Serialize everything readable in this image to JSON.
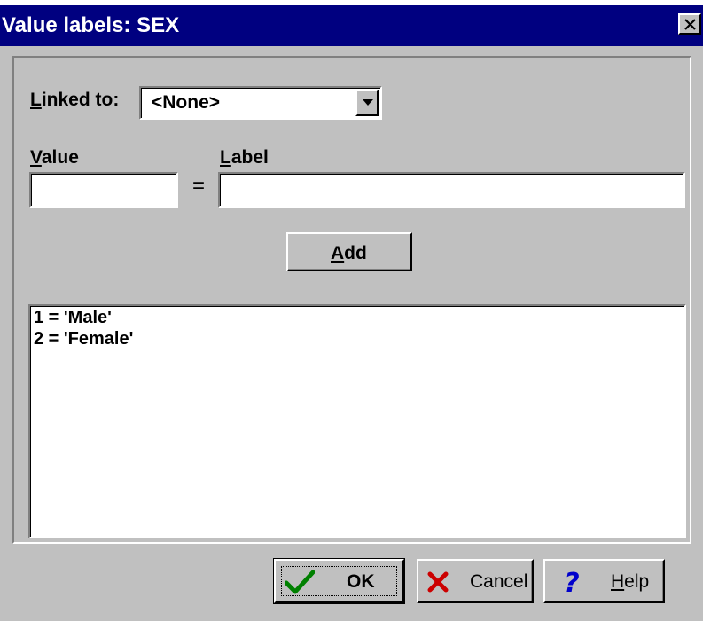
{
  "dialog": {
    "title": "Value labels: SEX",
    "close_icon": "close-x-icon"
  },
  "linked_to": {
    "label": "Linked to:",
    "selected": "<None>"
  },
  "value_field": {
    "label": "Value",
    "value": ""
  },
  "equals_sign": "=",
  "label_field": {
    "label": "Label",
    "value": ""
  },
  "add_button": {
    "label": "Add"
  },
  "value_list": {
    "items": [
      "1 = 'Male'",
      "2 = 'Female'"
    ]
  },
  "footer": {
    "ok": {
      "label": "OK",
      "icon": "checkmark-icon",
      "icon_color": "#008000"
    },
    "cancel": {
      "label": "Cancel",
      "icon": "red-x-icon",
      "icon_color": "#cc0000"
    },
    "help": {
      "label": "Help",
      "icon": "question-mark-icon",
      "icon_color": "#0000cc"
    }
  },
  "colors": {
    "titlebar": "#000080",
    "face": "#c0c0c0"
  }
}
